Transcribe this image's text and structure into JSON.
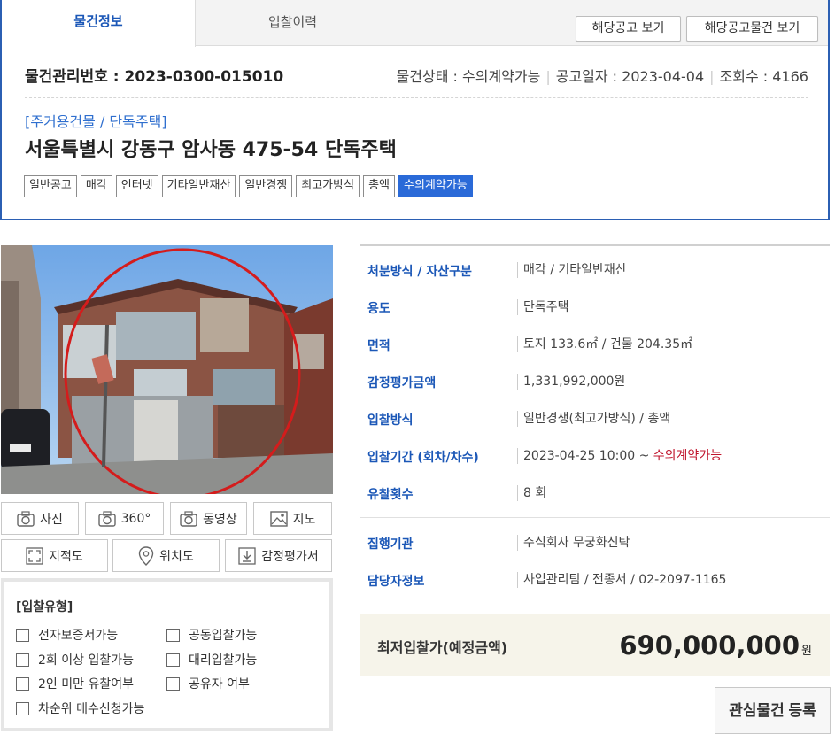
{
  "tabs": {
    "info": "물건정보",
    "history": "입찰이력"
  },
  "header_buttons": {
    "notice": "해당공고 보기",
    "notice_items": "해당공고물건 보기"
  },
  "meta": {
    "mgmt_label": "물건관리번호 :",
    "mgmt_number": "2023-0300-015010",
    "status": "물건상태 : 수의계약가능",
    "notice_date": "공고일자 : 2023-04-04",
    "views": "조회수 : 4166"
  },
  "category": "[주거용건물 / 단독주택]",
  "title": "서울특별시 강동구 암사동 475-54 단독주택",
  "tags": [
    "일반공고",
    "매각",
    "인터넷",
    "기타일반재산",
    "일반경쟁",
    "최고가방식",
    "총액",
    "수의계약가능"
  ],
  "media_buttons": {
    "photo": "사진",
    "view360": "360°",
    "video": "동영상",
    "map": "지도",
    "cadastral": "지적도",
    "location": "위치도",
    "appraisal": "감정평가서"
  },
  "bid_type": {
    "title": "[입찰유형]",
    "options": [
      "전자보증서가능",
      "공동입찰가능",
      "2회 이상 입찰가능",
      "대리입찰가능",
      "2인 미만 유찰여부",
      "공유자 여부",
      "차순위 매수신청가능"
    ]
  },
  "info_rows": [
    {
      "label": "처분방식 / 자산구분",
      "value": "매각 / 기타일반재산"
    },
    {
      "label": "용도",
      "value": "단독주택"
    },
    {
      "label": "면적",
      "value": "토지 133.6㎡ / 건물 204.35㎡"
    },
    {
      "label": "감정평가금액",
      "value": "1,331,992,000원"
    },
    {
      "label": "입찰방식",
      "value": "일반경쟁(최고가방식) / 총액"
    },
    {
      "label": "입찰기간 (회차/차수)",
      "value": "2023-04-25 10:00 ~ ",
      "value_red": "수의계약가능"
    },
    {
      "label": "유찰횟수",
      "value": "8 회"
    },
    {
      "label": "집행기관",
      "value": "주식회사 무궁화신탁"
    },
    {
      "label": "담당자정보",
      "value": "사업관리팀 / 전종서 / 02-2097-1165"
    }
  ],
  "min_bid": {
    "label": "최저입찰가(예정금액)",
    "amount": "690,000,000",
    "unit": "원"
  },
  "favorite_button": "관심물건 등록",
  "colors": {
    "accent": "#2b5fb3",
    "label_blue": "#1b57b7",
    "status_red": "#c0142c",
    "tag_highlight": "#2a6ad8"
  }
}
